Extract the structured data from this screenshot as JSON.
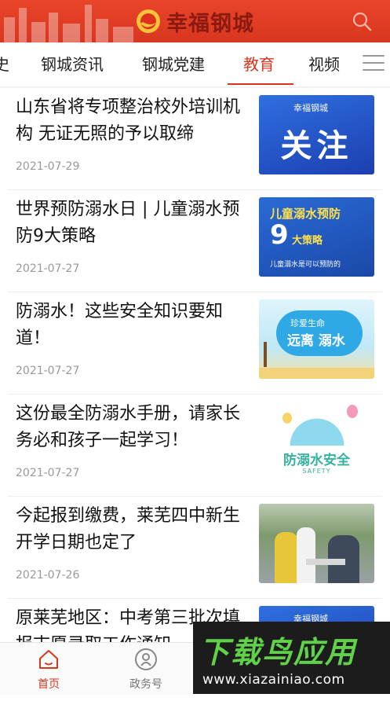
{
  "header": {
    "app_title": "幸福钢城",
    "logo_icon": "sunflower-logo-icon",
    "search_icon": "search-icon",
    "brand_color": "#d9361f"
  },
  "tabs": {
    "items": [
      {
        "label": "史"
      },
      {
        "label": "钢城资讯"
      },
      {
        "label": "钢城党建"
      },
      {
        "label": "教育"
      },
      {
        "label": "视频"
      }
    ],
    "active": "教育",
    "menu_icon": "hamburger-menu-icon"
  },
  "articles": [
    {
      "title": "山东省将专项整治校外培训机构 无证无照的予以取缔",
      "date": "2021-07-29",
      "thumb": {
        "brand": "幸福钢城",
        "headline": "关注"
      }
    },
    {
      "title": "世界预防溺水日 | 儿童溺水预防9大策略",
      "date": "2021-07-27",
      "thumb": {
        "line1": "儿童溺水预防",
        "number": "9",
        "line2": "大策略",
        "line3": "儿童溺水是可以预防的"
      }
    },
    {
      "title": "防溺水！这些安全知识要知道！",
      "date": "2021-07-27",
      "thumb": {
        "line1": "珍爱生命",
        "line2": "远离 溺水"
      }
    },
    {
      "title": "这份最全防溺水手册，请家长务必和孩子一起学习！",
      "date": "2021-07-27",
      "thumb": {
        "headline": "防溺水安全",
        "sub": "SAFETY"
      }
    },
    {
      "title": "今起报到缴费，莱芜四中新生开学日期也定了",
      "date": "2021-07-26",
      "thumb": {
        "description": "photo"
      }
    },
    {
      "title": "原莱芜地区：中考第三批次填报志愿录取工作通知",
      "date": "",
      "thumb": {
        "brand": "幸福钢城"
      }
    }
  ],
  "bottom_nav": {
    "items": [
      {
        "label": "首页",
        "icon": "home-icon"
      },
      {
        "label": "政务号",
        "icon": "government-badge-icon"
      }
    ],
    "active": "首页"
  },
  "watermark": {
    "title": "下载鸟应用",
    "url": "www.xiazainiao.com"
  }
}
